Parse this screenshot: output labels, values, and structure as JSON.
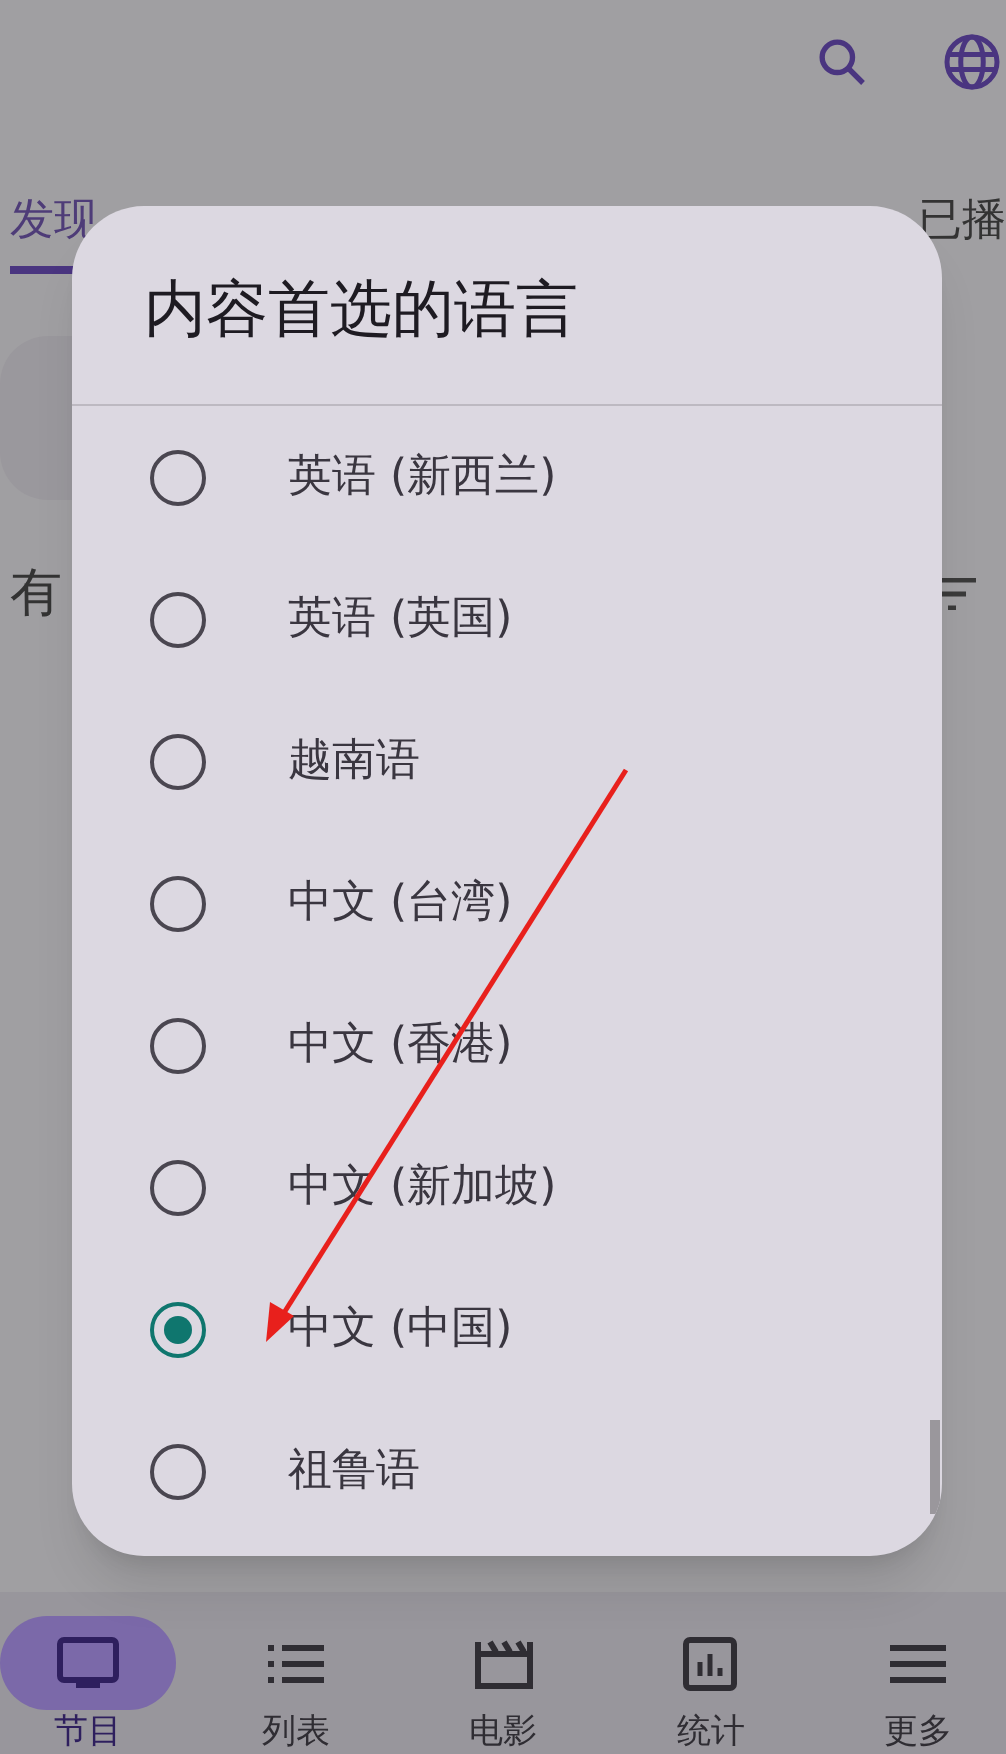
{
  "tabs": [
    {
      "label": "发现",
      "selected": true
    },
    {
      "label": "已播",
      "selected": false
    }
  ],
  "section": {
    "title": "有"
  },
  "dialog": {
    "title": "内容首选的语言",
    "options": [
      {
        "label": "英语 (新西兰)",
        "selected": false
      },
      {
        "label": "英语 (英国)",
        "selected": false
      },
      {
        "label": "越南语",
        "selected": false
      },
      {
        "label": "中文 (台湾)",
        "selected": false
      },
      {
        "label": "中文 (香港)",
        "selected": false
      },
      {
        "label": "中文 (新加坡)",
        "selected": false
      },
      {
        "label": "中文 (中国)",
        "selected": true
      },
      {
        "label": "祖鲁语",
        "selected": false
      }
    ]
  },
  "bottom_nav": [
    {
      "label": "节目",
      "selected": true
    },
    {
      "label": "列表",
      "selected": false
    },
    {
      "label": "电影",
      "selected": false
    },
    {
      "label": "统计",
      "selected": false
    },
    {
      "label": "更多",
      "selected": false
    }
  ]
}
